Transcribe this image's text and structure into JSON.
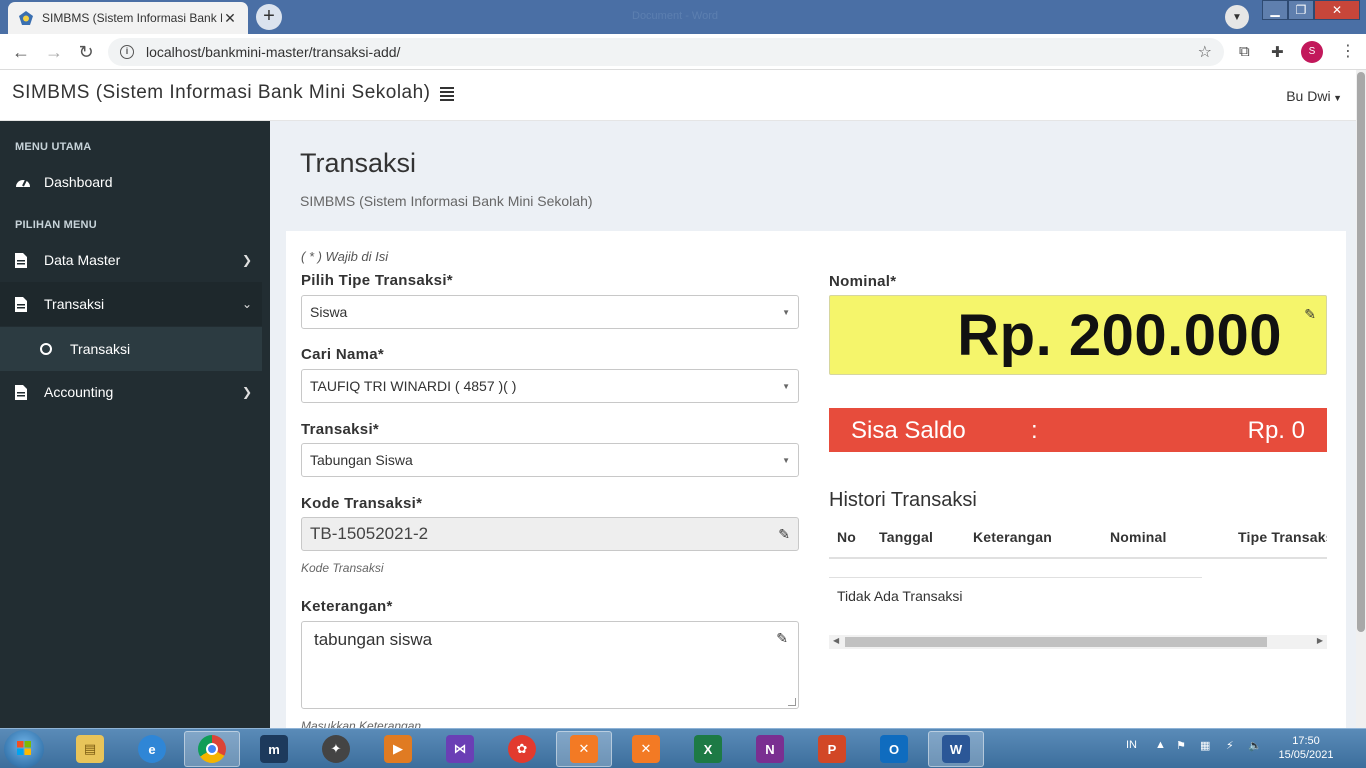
{
  "browser": {
    "tab_title": "SIMBMS (Sistem Informasi Bank Mini Sekolah)",
    "tab_close": "✕",
    "new_tab": "+",
    "window_title_faded": "Document - Word",
    "url": "localhost/bankmini-master/transaksi-add/",
    "profile_initial": "S"
  },
  "header": {
    "brand": "SIMBMS (Sistem Informasi Bank Mini Sekolah)",
    "user": "Bu Dwi"
  },
  "sidebar": {
    "header_main": "MENU UTAMA",
    "header_options": "PILIHAN MENU",
    "items": [
      {
        "label": "Dashboard",
        "icon": "dashboard-icon"
      },
      {
        "label": "Data Master",
        "icon": "file-icon"
      },
      {
        "label": "Transaksi",
        "icon": "file-icon"
      },
      {
        "label": "Accounting",
        "icon": "file-icon"
      }
    ],
    "submenu_label": "Transaksi"
  },
  "page": {
    "title": "Transaksi",
    "subtitle": "SIMBMS (Sistem Informasi Bank Mini Sekolah)"
  },
  "form": {
    "required_note": "( * ) Wajib di Isi",
    "tipe_label": "Pilih Tipe Transaksi*",
    "tipe_value": "Siswa",
    "nama_label": "Cari Nama*",
    "nama_value": "TAUFIQ TRI WINARDI ( 4857 )( )",
    "transaksi_label": "Transaksi*",
    "transaksi_value": "Tabungan Siswa",
    "kode_label": "Kode Transaksi*",
    "kode_value": "TB-15052021-2",
    "kode_help": "Kode Transaksi",
    "keterangan_label": "Keterangan*",
    "keterangan_value": "tabungan siswa",
    "keterangan_help": "Masukkan Keterangan",
    "nominal_label": "Nominal*",
    "nominal_value": "Rp. 200.000"
  },
  "saldo": {
    "label": "Sisa Saldo",
    "colon": ":",
    "value": "Rp. 0"
  },
  "history": {
    "title": "Histori Transaksi",
    "columns": [
      "No",
      "Tanggal",
      "Keterangan",
      "Nominal",
      "Tipe Transaksi"
    ],
    "empty": "Tidak Ada Transaksi"
  },
  "taskbar": {
    "lang": "IN",
    "time": "17:50",
    "date": "15/05/2021"
  },
  "colors": {
    "sidebar_bg": "#222d32",
    "nominal_bg": "#f5f56b",
    "saldo_bg": "#e74c3c"
  }
}
